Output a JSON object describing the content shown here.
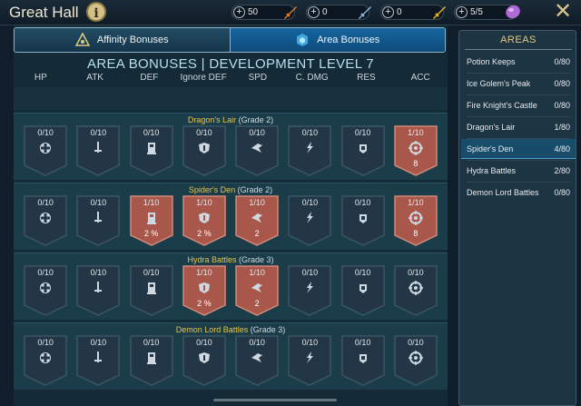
{
  "header": {
    "title": "Great Hall",
    "info_icon": "info-icon",
    "resources": [
      {
        "value": "50",
        "icon": "orange-sword-icon",
        "color": "#e07a2b"
      },
      {
        "value": "0",
        "icon": "blue-sword-icon",
        "color": "#8ab6d8"
      },
      {
        "value": "0",
        "icon": "gold-sword-icon",
        "color": "#e5b431"
      },
      {
        "value": "5/5",
        "icon": "purple-gem-icon",
        "color": "#b06ad6"
      }
    ],
    "close_icon": "close-icon"
  },
  "tabs": [
    {
      "label": "Affinity Bonuses",
      "icon": "affinity-icon"
    },
    {
      "label": "Area Bonuses",
      "icon": "area-icon"
    }
  ],
  "development_title": "AREA BONUSES | DEVELOPMENT LEVEL 7",
  "stat_headers": [
    "HP",
    "ATK",
    "DEF",
    "Ignore DEF",
    "SPD",
    "C. DMG",
    "RES",
    "ACC"
  ],
  "areas": [
    {
      "name": "Dragon's Lair",
      "grade": "(Grade 2)",
      "cells": [
        {
          "level": "0/10",
          "bonus": "",
          "active": false
        },
        {
          "level": "0/10",
          "bonus": "",
          "active": false
        },
        {
          "level": "0/10",
          "bonus": "",
          "active": false
        },
        {
          "level": "0/10",
          "bonus": "",
          "active": false
        },
        {
          "level": "0/10",
          "bonus": "",
          "active": false
        },
        {
          "level": "0/10",
          "bonus": "",
          "active": false
        },
        {
          "level": "0/10",
          "bonus": "",
          "active": false
        },
        {
          "level": "1/10",
          "bonus": "8",
          "active": true
        }
      ]
    },
    {
      "name": "Spider's Den",
      "grade": "(Grade 2)",
      "cells": [
        {
          "level": "0/10",
          "bonus": "",
          "active": false
        },
        {
          "level": "0/10",
          "bonus": "",
          "active": false
        },
        {
          "level": "1/10",
          "bonus": "2 %",
          "active": true
        },
        {
          "level": "1/10",
          "bonus": "2 %",
          "active": true
        },
        {
          "level": "1/10",
          "bonus": "2",
          "active": true
        },
        {
          "level": "0/10",
          "bonus": "",
          "active": false
        },
        {
          "level": "0/10",
          "bonus": "",
          "active": false
        },
        {
          "level": "1/10",
          "bonus": "8",
          "active": true
        }
      ]
    },
    {
      "name": "Hydra Battles",
      "grade": "(Grade 3)",
      "cells": [
        {
          "level": "0/10",
          "bonus": "",
          "active": false
        },
        {
          "level": "0/10",
          "bonus": "",
          "active": false
        },
        {
          "level": "0/10",
          "bonus": "",
          "active": false
        },
        {
          "level": "1/10",
          "bonus": "2 %",
          "active": true
        },
        {
          "level": "1/10",
          "bonus": "2",
          "active": true
        },
        {
          "level": "0/10",
          "bonus": "",
          "active": false
        },
        {
          "level": "0/10",
          "bonus": "",
          "active": false
        },
        {
          "level": "0/10",
          "bonus": "",
          "active": false
        }
      ]
    },
    {
      "name": "Demon Lord Battles",
      "grade": "(Grade 3)",
      "cells": [
        {
          "level": "0/10",
          "bonus": "",
          "active": false
        },
        {
          "level": "0/10",
          "bonus": "",
          "active": false
        },
        {
          "level": "0/10",
          "bonus": "",
          "active": false
        },
        {
          "level": "0/10",
          "bonus": "",
          "active": false
        },
        {
          "level": "0/10",
          "bonus": "",
          "active": false
        },
        {
          "level": "0/10",
          "bonus": "",
          "active": false
        },
        {
          "level": "0/10",
          "bonus": "",
          "active": false
        },
        {
          "level": "0/10",
          "bonus": "",
          "active": false
        }
      ]
    }
  ],
  "stat_icons": [
    "hp-icon",
    "atk-icon",
    "def-icon",
    "ignore-def-icon",
    "spd-icon",
    "c-dmg-icon",
    "res-icon",
    "acc-icon"
  ],
  "sidebar": {
    "title": "AREAS",
    "items": [
      {
        "name": "Potion Keeps",
        "value": "0/80"
      },
      {
        "name": "Ice Golem's Peak",
        "value": "0/80"
      },
      {
        "name": "Fire Knight's Castle",
        "value": "0/80"
      },
      {
        "name": "Dragon's Lair",
        "value": "1/80"
      },
      {
        "name": "Spider's Den",
        "value": "4/80"
      },
      {
        "name": "Hydra Battles",
        "value": "2/80"
      },
      {
        "name": "Demon Lord Battles",
        "value": "0/80"
      }
    ],
    "selected_index": 4
  },
  "colors": {
    "active_cell": "#a8574a",
    "inactive_cell": "#223645",
    "area_name": "#e3c54a",
    "accent": "#1565a0"
  }
}
